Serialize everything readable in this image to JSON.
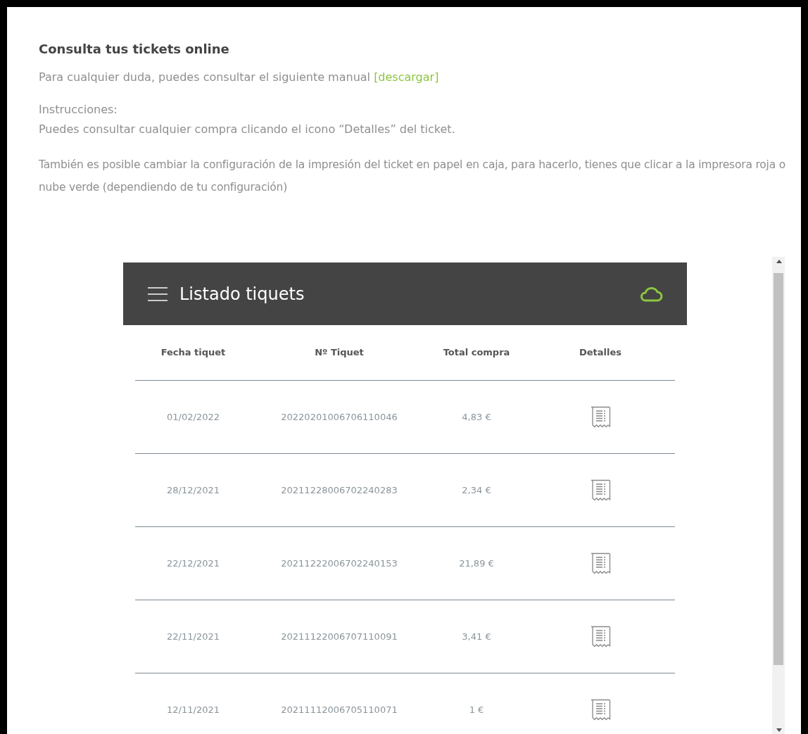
{
  "title": "Consulta tus tickets online",
  "intro": {
    "text": "Para cualquier duda, puedes consultar el siguiente manual",
    "link": "[descargar]"
  },
  "instructions_label": "Instrucciones:",
  "instructions": [
    "Puedes consultar cualquier compra clicando el icono “Detalles” del ticket.",
    "También es posible cambiar la configuración de la impresión del ticket en papel en caja, para hacerlo, tienes que clicar a la impresora roja o nube verde (dependiendo de tu configuración)"
  ],
  "app": {
    "title": "Listado tiquets",
    "columns": [
      "Fecha tiquet",
      "Nº Tiquet",
      "Total compra",
      "Detalles"
    ],
    "rows": [
      {
        "date": "01/02/2022",
        "number": "20220201006706110046",
        "total": "4,83 €"
      },
      {
        "date": "28/12/2021",
        "number": "20211228006702240283",
        "total": "2,34 €"
      },
      {
        "date": "22/12/2021",
        "number": "20211222006702240153",
        "total": "21,89 €"
      },
      {
        "date": "22/11/2021",
        "number": "20211122006707110091",
        "total": "3,41 €"
      },
      {
        "date": "12/11/2021",
        "number": "20211112006705110071",
        "total": "1 €"
      }
    ]
  }
}
